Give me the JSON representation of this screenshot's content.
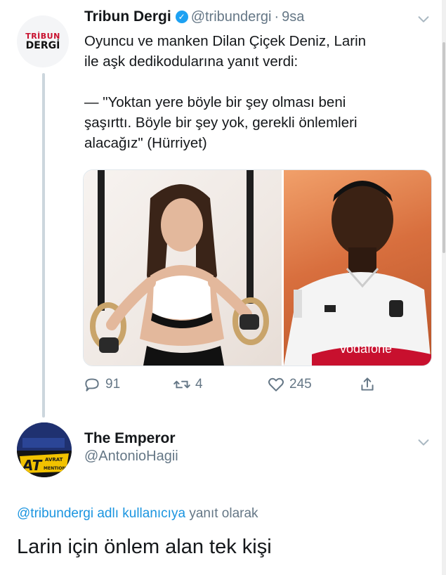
{
  "tweet": {
    "avatar_line1": "TRİBUN",
    "avatar_line2": "DERGİ",
    "name": "Tribun Dergi",
    "handle": "@tribundergi",
    "separator": "·",
    "time": "9sa",
    "text_line1": "Oyuncu ve manken Dilan Çiçek Deniz, Larin",
    "text_line2": "ile aşk dedikodularına yanıt verdi:",
    "quote_line1": "— \"Yoktan yere böyle bir şey olması beni",
    "quote_line2": "şaşırttı. Böyle bir şey yok, gerekli önlemleri",
    "quote_line3": "alacağız\" (Hürriyet)",
    "shirt_text": "vodafone",
    "replies": "91",
    "retweets": "4",
    "likes": "245"
  },
  "reply": {
    "name": "The Emperor",
    "handle": "@AntonioHagii",
    "avatar_text_main": "AT",
    "avatar_text_sub1": "AVRAT",
    "avatar_text_sub2": "MENTION",
    "replying_link": "@tribundergi adlı kullanıcıya",
    "replying_rest": "yanıt olarak",
    "text": "Larin için önlem alan tek kişi"
  },
  "colors": {
    "link": "#1b95e0",
    "secondary": "#657786",
    "verified": "#1da1f2"
  }
}
